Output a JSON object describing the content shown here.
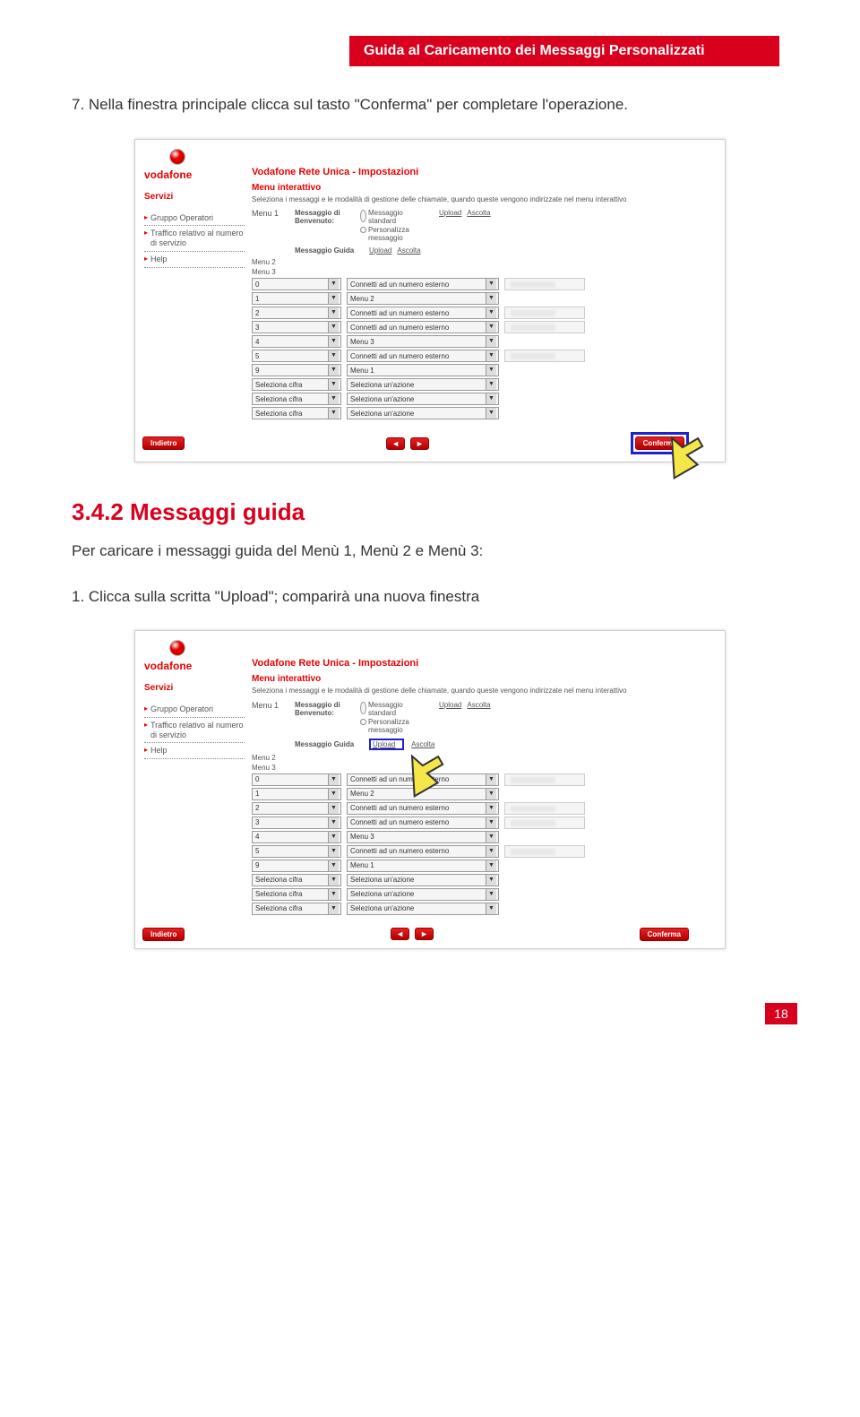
{
  "doc": {
    "header": "Guida al Caricamento dei Messaggi Personalizzati",
    "step7": "7.   Nella finestra principale clicca sul tasto \"Conferma\" per completare l'operazione.",
    "section": "3.4.2 Messaggi guida",
    "section_intro": "Per caricare i messaggi guida del Menù 1, Menù 2 e Menù 3:",
    "step1b": "1.   Clicca sulla scritta \"Upload\"; comparirà una nuova finestra",
    "page_num": "18"
  },
  "app": {
    "brand": "vodafone",
    "servizi": "Servizi",
    "side": [
      "Gruppo Operatori",
      "Traffico relativo al numero di servizio",
      "Help"
    ],
    "title": "Vodafone Rete Unica - Impostazioni",
    "subtitle": "Menu interattivo",
    "descr": "Seleziona i messaggi e le modalità di gestione delle chiamate, quando queste vengono indirizzate nel menu interattivo",
    "menu1": "Menu 1",
    "benv": "Messaggio di Benvenuto:",
    "radio1": "Messaggio standard",
    "radio2": "Personalizza messaggio",
    "upload": "Upload",
    "ascolta": "Ascolta",
    "guida": "Messaggio Guida",
    "menu2": "Menu 2",
    "menu3": "Menu 3",
    "rows": [
      {
        "c1": "0",
        "c2": "Connetti ad un numero esterno",
        "ext": true
      },
      {
        "c1": "1",
        "c2": "Menu 2",
        "ext": false
      },
      {
        "c1": "2",
        "c2": "Connetti ad un numero esterno",
        "ext": true
      },
      {
        "c1": "3",
        "c2": "Connetti ad un numero esterno",
        "ext": true
      },
      {
        "c1": "4",
        "c2": "Menu 3",
        "ext": false
      },
      {
        "c1": "5",
        "c2": "Connetti ad un numero esterno",
        "ext": true
      },
      {
        "c1": "9",
        "c2": "Menu 1",
        "ext": false
      },
      {
        "c1": "Seleziona cifra",
        "c2": "Seleziona un'azione",
        "ext": false
      },
      {
        "c1": "Seleziona cifra",
        "c2": "Seleziona un'azione",
        "ext": false
      },
      {
        "c1": "Seleziona cifra",
        "c2": "Seleziona un'azione",
        "ext": false
      }
    ],
    "indietro": "Indietro",
    "conferma": "Conferma",
    "prev": "◄",
    "next": "►"
  }
}
